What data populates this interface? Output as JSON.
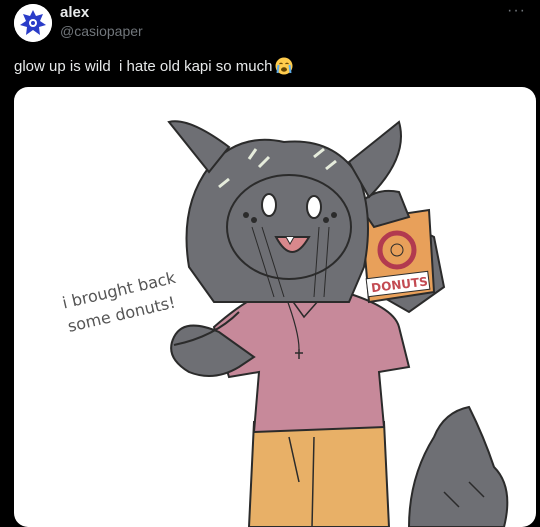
{
  "post": {
    "display_name": "alex",
    "handle": "@casiopaper",
    "more_label": "···",
    "text": "glow up is wild  i hate old kapi so much",
    "emoji": "loudly-crying-face-icon"
  },
  "media": {
    "speech_line1": "i brought back",
    "speech_line2": "some donuts!",
    "bag_label": "DONUTS"
  },
  "colors": {
    "background": "#000000",
    "text": "#e7e9ea",
    "secondary": "#71767b",
    "fur": "#6e6f74",
    "shirt": "#c7899a",
    "pants": "#e8b067",
    "bag": "#e8a05a"
  }
}
